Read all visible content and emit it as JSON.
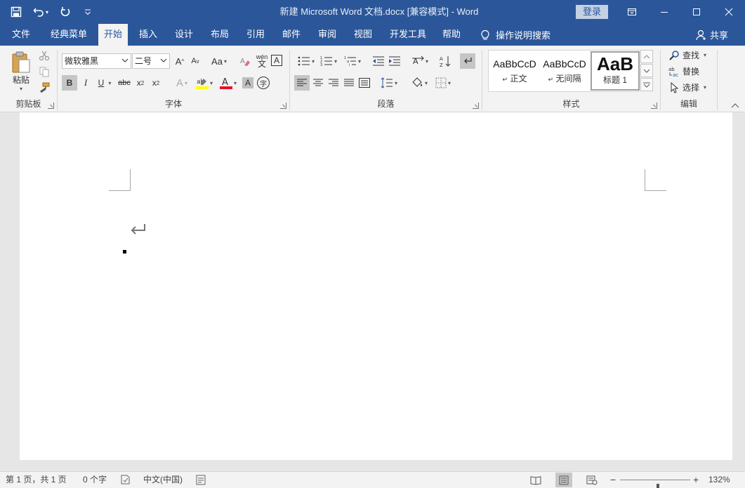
{
  "titlebar": {
    "title": "新建 Microsoft Word 文档.docx [兼容模式]  -  Word",
    "login_label": "登录",
    "bg_color": "#2b579a"
  },
  "tabs": [
    {
      "label": "文件"
    },
    {
      "label": "经典菜单"
    },
    {
      "label": "开始",
      "active": true
    },
    {
      "label": "插入"
    },
    {
      "label": "设计"
    },
    {
      "label": "布局"
    },
    {
      "label": "引用"
    },
    {
      "label": "邮件"
    },
    {
      "label": "审阅"
    },
    {
      "label": "视图"
    },
    {
      "label": "开发工具"
    },
    {
      "label": "帮助"
    }
  ],
  "tell_me": "操作说明搜索",
  "share": "共享",
  "ribbon": {
    "clipboard": {
      "label": "剪贴板",
      "paste_label": "粘贴"
    },
    "font": {
      "label": "字体",
      "font_name": "微软雅黑",
      "font_size": "二号",
      "change_case": "Aa",
      "bold": "B",
      "italic": "I",
      "underline": "U",
      "strike": "abc",
      "sub": "x",
      "sup": "x",
      "phonetic_top": "wén",
      "phonetic_bottom": "文",
      "char_border": "A",
      "font_color_letter": "A",
      "char_shading": "A",
      "enclose": "字",
      "highlight_color": "#ffff00",
      "font_color": "#e81123"
    },
    "paragraph": {
      "label": "段落"
    },
    "styles": {
      "label": "样式",
      "items": [
        {
          "preview": "AaBbCcD",
          "name": "正文"
        },
        {
          "preview": "AaBbCcD",
          "name": "无间隔"
        },
        {
          "preview": "AaB",
          "name": "标题 1",
          "active": true
        }
      ]
    },
    "editing": {
      "label": "编辑",
      "find": "查找",
      "replace": "替换",
      "select": "选择"
    }
  },
  "statusbar": {
    "page_info": "第 1 页，共 1 页",
    "word_count": "0 个字",
    "language": "中文(中国)",
    "zoom_minus": "−",
    "zoom_plus": "+",
    "zoom_percent": "132%",
    "zoom_level": 132
  }
}
